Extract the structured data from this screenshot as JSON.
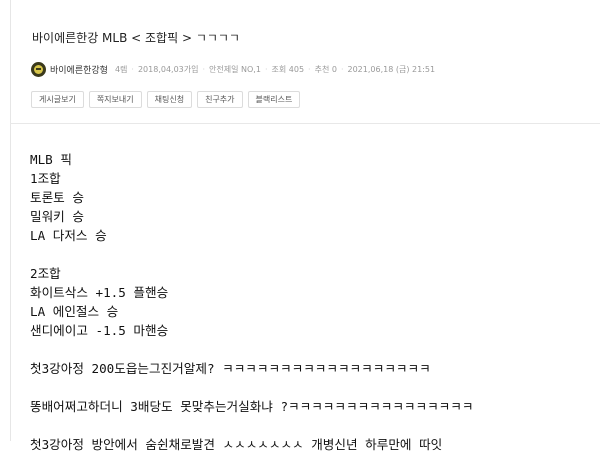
{
  "post": {
    "title": "바이에른한강 MLB < 조합픽 > ㄱㄱㄱㄱ",
    "author": "바이에른한강형",
    "meta": [
      "4렙",
      "2018,04,03가입",
      "안전제일 NO,1",
      "조회 405",
      "추천 0",
      "2021,06,18 (금) 21:51"
    ]
  },
  "actions": {
    "posts": "게시글보기",
    "message": "쪽지보내기",
    "chat": "채팅신청",
    "friend": "친구추가",
    "block": "블랙리스트"
  },
  "content": {
    "lines": [
      "MLB 픽",
      "1조합",
      "토론토 승",
      "밀워키 승",
      "LA 다저스 승",
      "",
      "2조합",
      "화이트삭스 +1.5 플핸승",
      "LA 에인절스 승",
      "샌디에이고 -1.5 마핸승",
      "",
      "첫3강아정 200도읍는그진거알제? ㅋㅋㅋㅋㅋㅋㅋㅋㅋㅋㅋㅋㅋㅋㅋㅋㅋㅋ",
      "",
      "똥배어쩌고하더니 3배당도 못맞추는거실화냐 ?ㅋㅋㅋㅋㅋㅋㅋㅋㅋㅋㅋㅋㅋㅋㅋㅋ",
      "",
      "첫3강아정 방안에서 숨쉰채로발견 ㅅㅅㅅㅅㅅㅅㅅ 개병신년 하루만에 따잇"
    ]
  }
}
